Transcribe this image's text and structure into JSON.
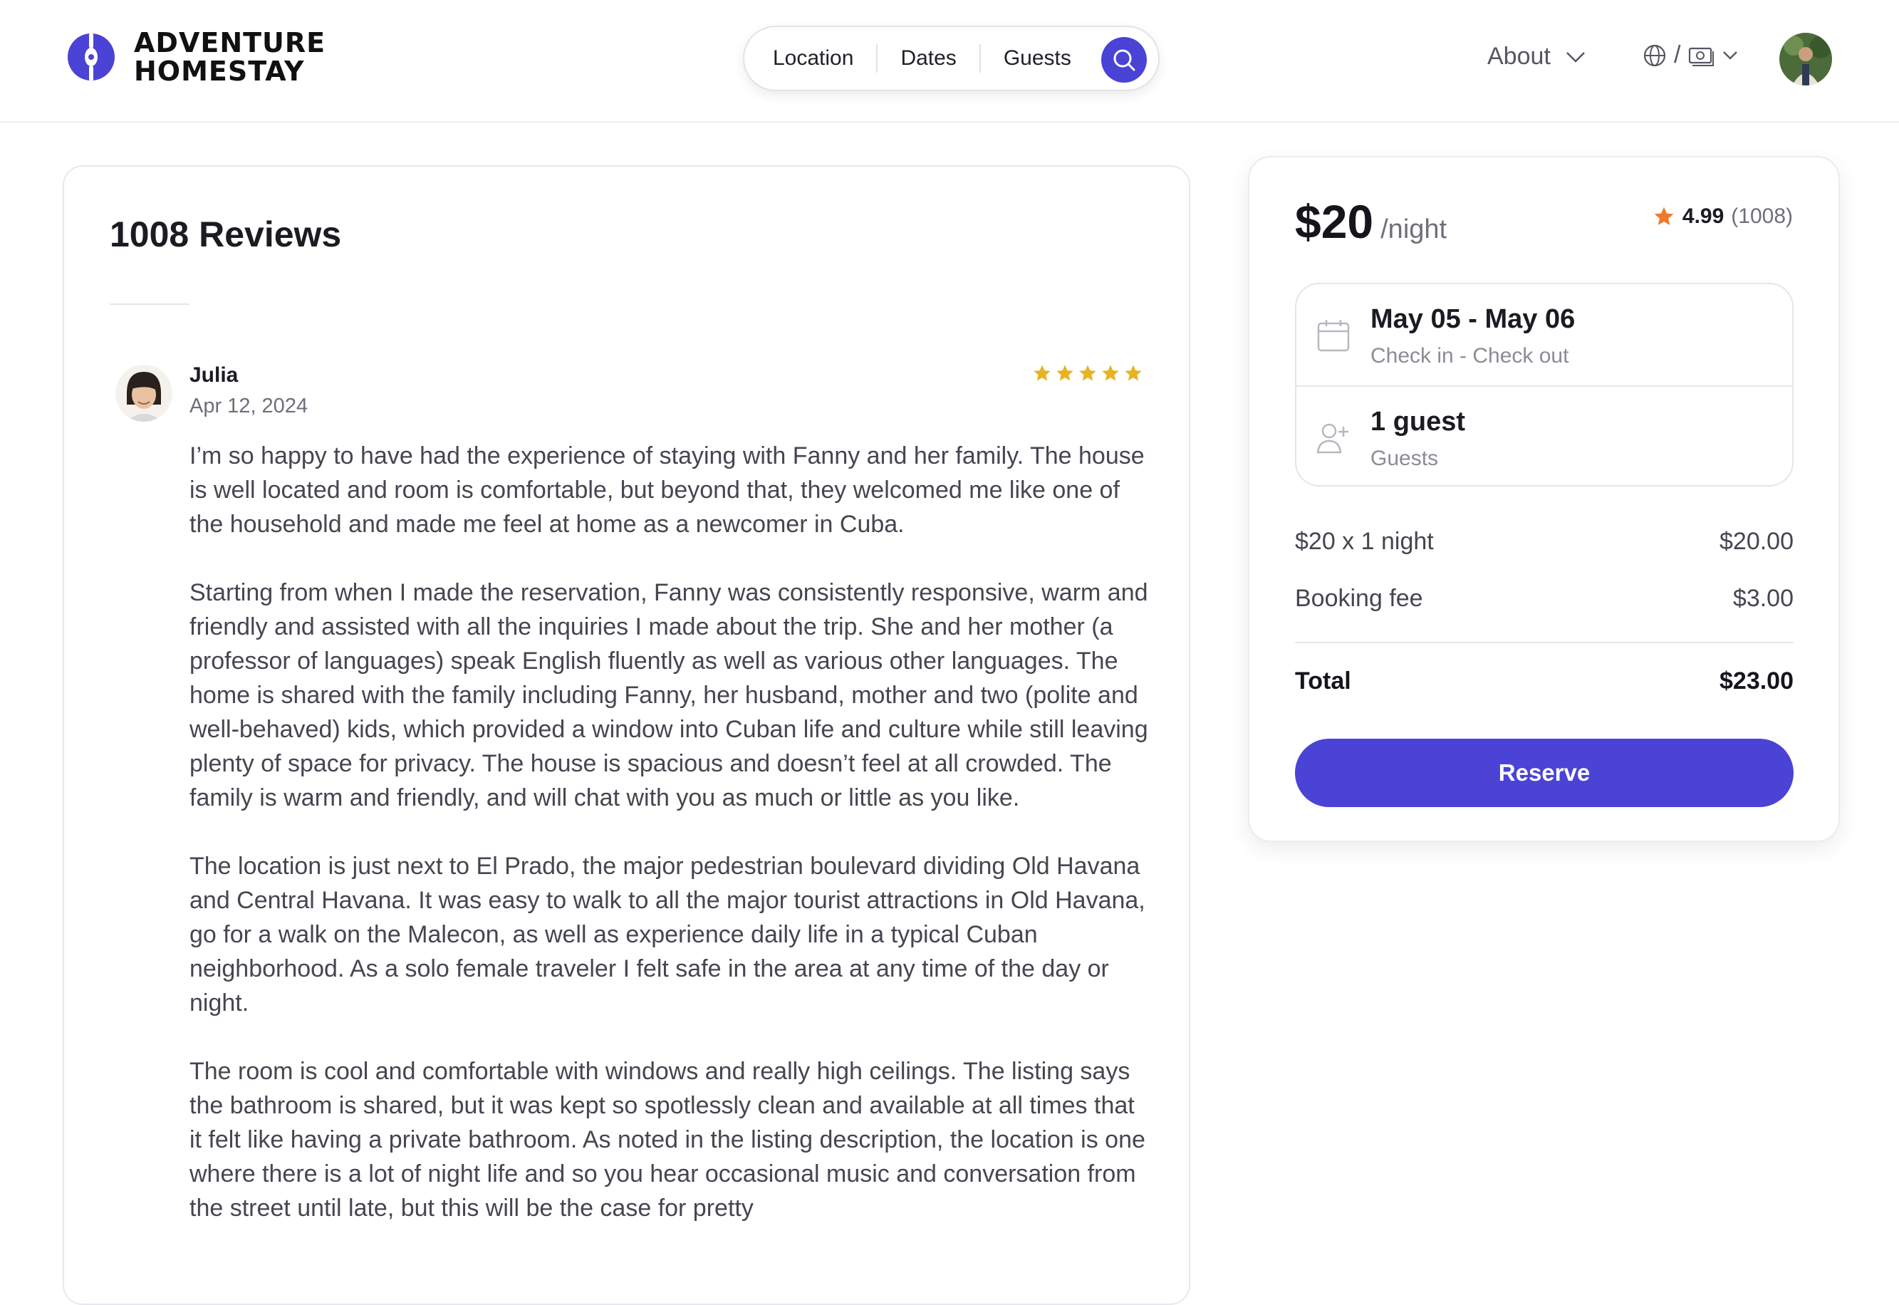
{
  "brand": {
    "line1": "ADVENTURE",
    "line2": "HOMESTAY",
    "accent_color": "#4a43d6"
  },
  "search": {
    "location_label": "Location",
    "dates_label": "Dates",
    "guests_label": "Guests",
    "button_icon": "search-icon"
  },
  "nav": {
    "about_label": "About",
    "about_icon": "chevron-down-icon",
    "locale_separator": "/",
    "language_icon": "globe-icon",
    "currency_icon": "banknote-icon",
    "profile_icon": "user-avatar"
  },
  "reviews": {
    "title": "1008 Reviews",
    "items": [
      {
        "name": "Julia",
        "date": "Apr 12, 2024",
        "rating": 5,
        "star_color": "#e6b422",
        "paragraphs": [
          "I’m so happy to have had the experience of staying with Fanny and her family. The house is well located and room is comfortable, but beyond that, they welcomed me like one of the household and made me feel at home as a newcomer in Cuba.",
          "Starting from when I made the reservation, Fanny was consistently responsive, warm and friendly and assisted with all the inquiries I made about the trip. She and her mother (a professor of languages) speak English fluently as well as various other languages. The home is shared with the family including Fanny, her husband, mother and two (polite and well-behaved) kids, which provided a window into Cuban life and culture while still leaving plenty of space for privacy. The house is spacious and doesn’t feel at all crowded. The family is warm and friendly, and will chat with you as much or little as you like.",
          "The location is just next to El Prado, the major pedestrian boulevard dividing Old Havana and Central Havana. It was easy to walk to all the major tourist attractions in Old Havana, go for a walk on the Malecon, as well as experience daily life in a typical Cuban neighborhood. As a solo female traveler I felt safe in the area at any time of the day or night.",
          "The room is cool and comfortable with windows and really high ceilings. The listing says the bathroom is shared, but it was kept so spotlessly clean and available at all times that it felt like having a private bathroom. As noted in the listing description, the location is one where there is a lot of night life and so you hear occasional music and conversation from the street until late, but this will be the case for pretty"
        ]
      }
    ]
  },
  "booking": {
    "price": "$20",
    "price_unit": "/night",
    "rating_value": "4.99",
    "rating_count": "(1008)",
    "rating_star_color": "#f07a2a",
    "dates_value": "May 05 - May 06",
    "dates_caption": "Check in - Check out",
    "dates_icon": "calendar-icon",
    "guests_value": "1 guest",
    "guests_caption": "Guests",
    "guests_icon": "add-user-icon",
    "nights_label": "$20 x 1 night",
    "nights_amount": "$20.00",
    "fee_label": "Booking fee",
    "fee_amount": "$3.00",
    "total_label": "Total",
    "total_amount": "$23.00",
    "reserve_label": "Reserve"
  }
}
